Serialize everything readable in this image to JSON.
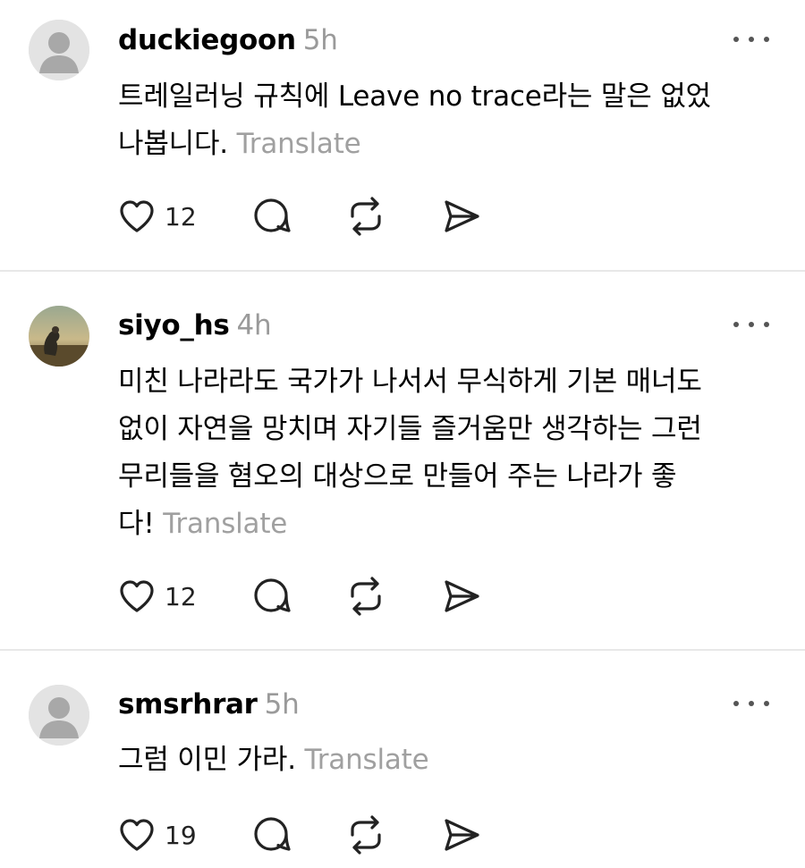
{
  "posts": [
    {
      "username": "duckiegoon",
      "time": "5h",
      "lines": [
        "트레일러닝 규칙에 Leave no trace라는 말은 없었",
        "나봅니다."
      ],
      "translate_label": "Translate",
      "likes": "12",
      "avatar": "default-avatar"
    },
    {
      "username": "siyo_hs",
      "time": "4h",
      "lines": [
        "미친 나라라도 국가가 나서서 무식하게 기본 매너도",
        "없이 자연을 망치며 자기들 즐거움만 생각하는 그런",
        "무리들을 혐오의 대상으로 만들어 주는 나라가 좋",
        "다!"
      ],
      "translate_label": "Translate",
      "likes": "12",
      "avatar": "photo-avatar"
    },
    {
      "username": "smsrhrar",
      "time": "5h",
      "lines": [
        "그럼 이민 가라."
      ],
      "translate_label": "Translate",
      "likes": "19",
      "avatar": "default-avatar"
    }
  ],
  "icons": {
    "like": "heart-icon",
    "reply": "comment-icon",
    "repost": "repost-icon",
    "share": "send-icon",
    "more": "more-icon"
  },
  "colors": {
    "text": "#000000",
    "muted": "#9a9a9a",
    "divider": "#e8e8e8",
    "icon": "#222222",
    "avatar_bg": "#e3e3e3",
    "avatar_fg": "#a8a8a8"
  }
}
